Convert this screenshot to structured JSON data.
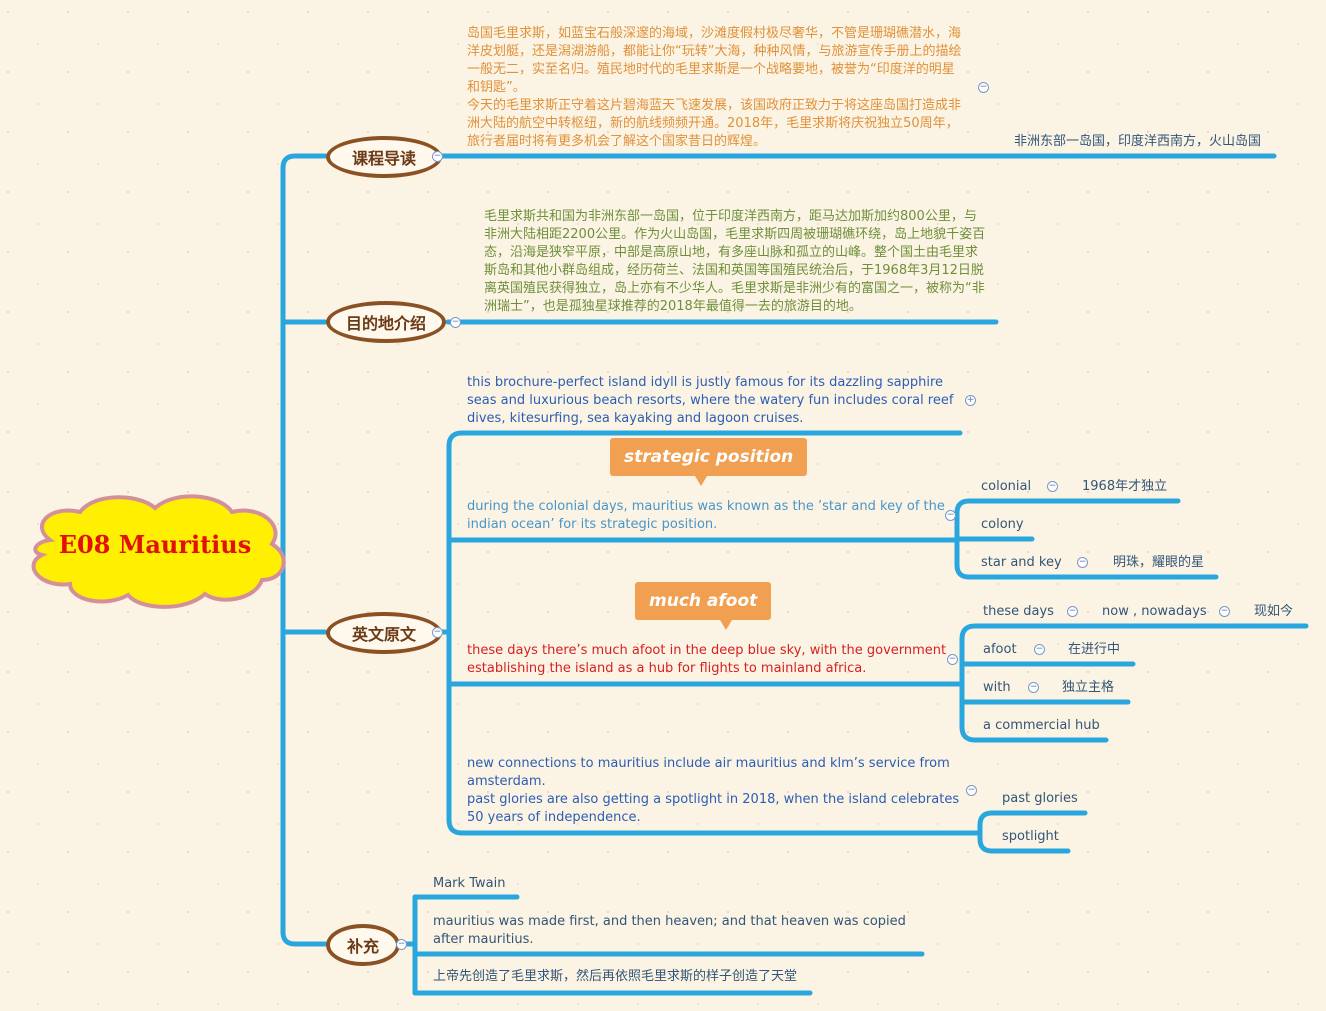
{
  "central": {
    "title": "E08 Mauritius"
  },
  "branches": {
    "intro": {
      "label": "课程导读",
      "note": "岛国毛里求斯，如蓝宝石般深邃的海域，沙滩度假村极尽奢华，不管是珊瑚礁潜水，海洋皮划艇，还是潟湖游船，都能让你“玩转”大海，种种风情，与旅游宣传手册上的描绘一般无二，实至名归。殖民地时代的毛里求斯是一个战略要地，被誉为“印度洋的明星和钥匙”。\n今天的毛里求斯正守着这片碧海蓝天飞速发展，该国政府正致力于将这座岛国打造成非洲大陆的航空中转枢纽，新的航线频频开通。2018年，毛里求斯将庆祝独立50周年，旅行者届时将有更多机会了解这个国家昔日的辉煌。",
      "child": "非洲东部一岛国，印度洋西南方，火山岛国"
    },
    "destination": {
      "label": "目的地介绍",
      "note": "毛里求斯共和国为非洲东部一岛国，位于印度洋西南方，距马达加斯加约800公里，与非洲大陆相距2200公里。作为火山岛国，毛里求斯四周被珊瑚礁环绕，岛上地貌千姿百态，沿海是狭窄平原，中部是高原山地，有多座山脉和孤立的山峰。整个国土由毛里求斯岛和其他小群岛组成，经历荷兰、法国和英国等国殖民统治后，于1968年3月12日脱离英国殖民获得独立，岛上亦有不少华人。毛里求斯是非洲少有的富国之一，被称为“非洲瑞士”，也是孤独星球推荐的2018年最值得一去的旅游目的地。"
    },
    "original": {
      "label": "英文原文",
      "p1": "this brochure-perfect island idyll is justly famous for its dazzling sapphire seas and luxurious beach resorts, where the watery fun includes coral reef dives, kitesurfing, sea kayaking and lagoon cruises.",
      "callout1": "strategic position",
      "p2": "during the colonial days, mauritius was known as the ’star and key of the indian ocean’ for its strategic position.",
      "p2_children": {
        "colonial": "colonial",
        "colonial_note": "1968年才独立",
        "colony": "colony",
        "star": "star and key",
        "star_note": "明珠，耀眼的星"
      },
      "callout2": "much afoot",
      "p3": "these days there’s much afoot in the deep blue sky, with the government establishing the island as a hub for flights to mainland africa.",
      "p3_children": {
        "these_days": "these days",
        "now": "now , nowadays",
        "now_note": "现如今",
        "afoot": "afoot",
        "afoot_note": "在进行中",
        "with": "with",
        "with_note": "独立主格",
        "hub": "a commercial hub"
      },
      "p4": "new connections to mauritius include air mauritius and klm’s service from amsterdam.\npast glories are also getting a spotlight in 2018, when the island celebrates 50 years of independence.",
      "p4_children": {
        "glories": "past glories",
        "spotlight": "spotlight"
      }
    },
    "supplement": {
      "label": "补充",
      "author": "Mark Twain",
      "quote": "mauritius was made first, and then heaven; and that heaven was copied after mauritius.",
      "translation": "上帝先创造了毛里求斯，然后再依照毛里求斯的样子创造了天堂"
    }
  },
  "colors": {
    "line": "#29a6de",
    "cloud_fill": "#ffef00",
    "cloud_stroke": "#d4909a",
    "node_border": "#8a5224"
  }
}
